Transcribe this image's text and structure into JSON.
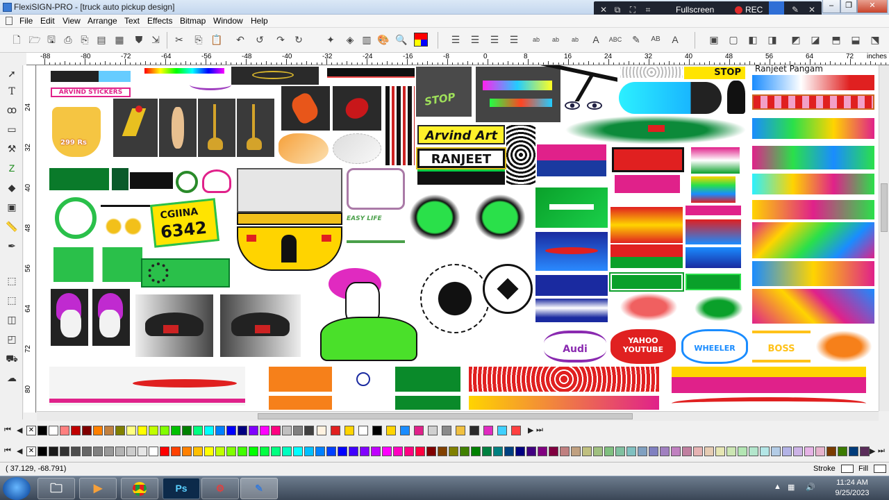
{
  "window": {
    "title": "FlexiSIGN-PRO - [truck auto pickup design]"
  },
  "recorder": {
    "fullscreen_label": "Fullscreen",
    "rec_label": "REC"
  },
  "menu": [
    "File",
    "Edit",
    "View",
    "Arrange",
    "Text",
    "Effects",
    "Bitmap",
    "Window",
    "Help"
  ],
  "ruler": {
    "unit_label": "inches",
    "h_ticks": [
      "-88",
      "-80",
      "-72",
      "-64",
      "-56",
      "-48",
      "-40",
      "-32",
      "-24",
      "-16",
      "-8",
      "0",
      "8",
      "16",
      "24",
      "32",
      "40",
      "48",
      "56",
      "64",
      "72"
    ],
    "v_ticks": [
      "24",
      "32",
      "40",
      "48",
      "56",
      "64",
      "72",
      "80"
    ]
  },
  "canvas_text": {
    "arvind_art": "Arvind Art",
    "ranjeet": "RANJEET",
    "stop": "STOP",
    "ranjeet_pangam": "Ranjeet Pangam",
    "plate_top": "CGIINA",
    "plate_num": "6342",
    "arvind_stickers": "ARVIND STICKERS",
    "wheeler": "WHEELER",
    "yahoo": "YAHOO",
    "youtube": "YOUTUBE",
    "boss": "BOSS",
    "easy_life": "EASY LIFE",
    "audi": "Audi",
    "price_line": "299 Rs"
  },
  "status": {
    "coords": "( 37.129,   -68.791)",
    "stroke_label": "Stroke",
    "fill_label": "Fill"
  },
  "taskbar": {
    "time": "11:24 AM",
    "date": "9/25/2023"
  },
  "palette_colors_row1": [
    "#000000",
    "#ffffff",
    "#ff7f7f",
    "#c00000",
    "#800000",
    "#ff8000",
    "#c08040",
    "#808000",
    "#ffff80",
    "#ffff00",
    "#c0ff00",
    "#80ff00",
    "#00c000",
    "#008000",
    "#00ff80",
    "#00ffff",
    "#0080ff",
    "#0000ff",
    "#000080",
    "#8000ff",
    "#ff00ff",
    "#ff0080",
    "#c0c0c0",
    "#808080",
    "#404040"
  ],
  "palette_colors_row2": [
    "#000000",
    "#1a1a1a",
    "#333333",
    "#4d4d4d",
    "#666666",
    "#808080",
    "#999999",
    "#b3b3b3",
    "#cccccc",
    "#e6e6e6",
    "#ffffff",
    "#ff0000",
    "#ff4000",
    "#ff8000",
    "#ffbf00",
    "#ffff00",
    "#bfff00",
    "#80ff00",
    "#40ff00",
    "#00ff00",
    "#00ff40",
    "#00ff80",
    "#00ffbf",
    "#00ffff",
    "#00bfff",
    "#0080ff",
    "#0040ff",
    "#0000ff",
    "#4000ff",
    "#8000ff",
    "#bf00ff",
    "#ff00ff",
    "#ff00bf",
    "#ff0080",
    "#ff0040",
    "#800000",
    "#804000",
    "#808000",
    "#408000",
    "#008000",
    "#008040",
    "#008080",
    "#004080",
    "#000080",
    "#400080",
    "#800080",
    "#800040",
    "#c08080",
    "#c0a080",
    "#c0c080",
    "#a0c080",
    "#80c080",
    "#80c0a0",
    "#80c0c0",
    "#80a0c0",
    "#8080c0",
    "#a080c0",
    "#c080c0",
    "#c080a0",
    "#e6b3b3",
    "#e6ccb3",
    "#e6e6b3",
    "#cce6b3",
    "#b3e6b3",
    "#b3e6cc",
    "#b3e6e6",
    "#b3cce6",
    "#b3b3e6",
    "#ccb3e6",
    "#e6b3e6",
    "#e6b3cc",
    "#7a3b00",
    "#3b7a00",
    "#003b7a",
    "#5a2d5a"
  ]
}
